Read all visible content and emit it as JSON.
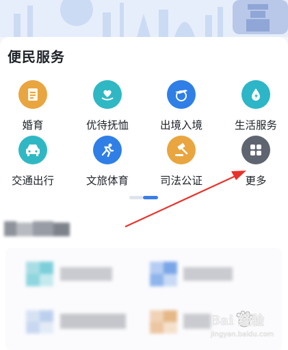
{
  "section": {
    "title": "便民服务"
  },
  "services": [
    {
      "label": "婚育",
      "icon": "marriage-document-icon",
      "color": "#e9a53f"
    },
    {
      "label": "优待抚恤",
      "icon": "heart-hand-icon",
      "color": "#2fb8c4"
    },
    {
      "label": "出境入境",
      "icon": "airplane-globe-icon",
      "color": "#2f7fe6"
    },
    {
      "label": "生活服务",
      "icon": "water-bolt-icon",
      "color": "#2cb6c7"
    },
    {
      "label": "交通出行",
      "icon": "car-icon",
      "color": "#2fb8c4"
    },
    {
      "label": "文旅体育",
      "icon": "runner-icon",
      "color": "#2f7fe6"
    },
    {
      "label": "司法公证",
      "icon": "gavel-icon",
      "color": "#e9a53f"
    },
    {
      "label": "更多",
      "icon": "grid-more-icon",
      "color": "#5e6470"
    }
  ],
  "pager": {
    "pages": 2,
    "active": 2
  },
  "watermark": {
    "brand": "Bai 经验",
    "url": "jingyan.baidu.com"
  },
  "colors": {
    "accent": "#3a7de6",
    "arrow": "#e8322b"
  }
}
